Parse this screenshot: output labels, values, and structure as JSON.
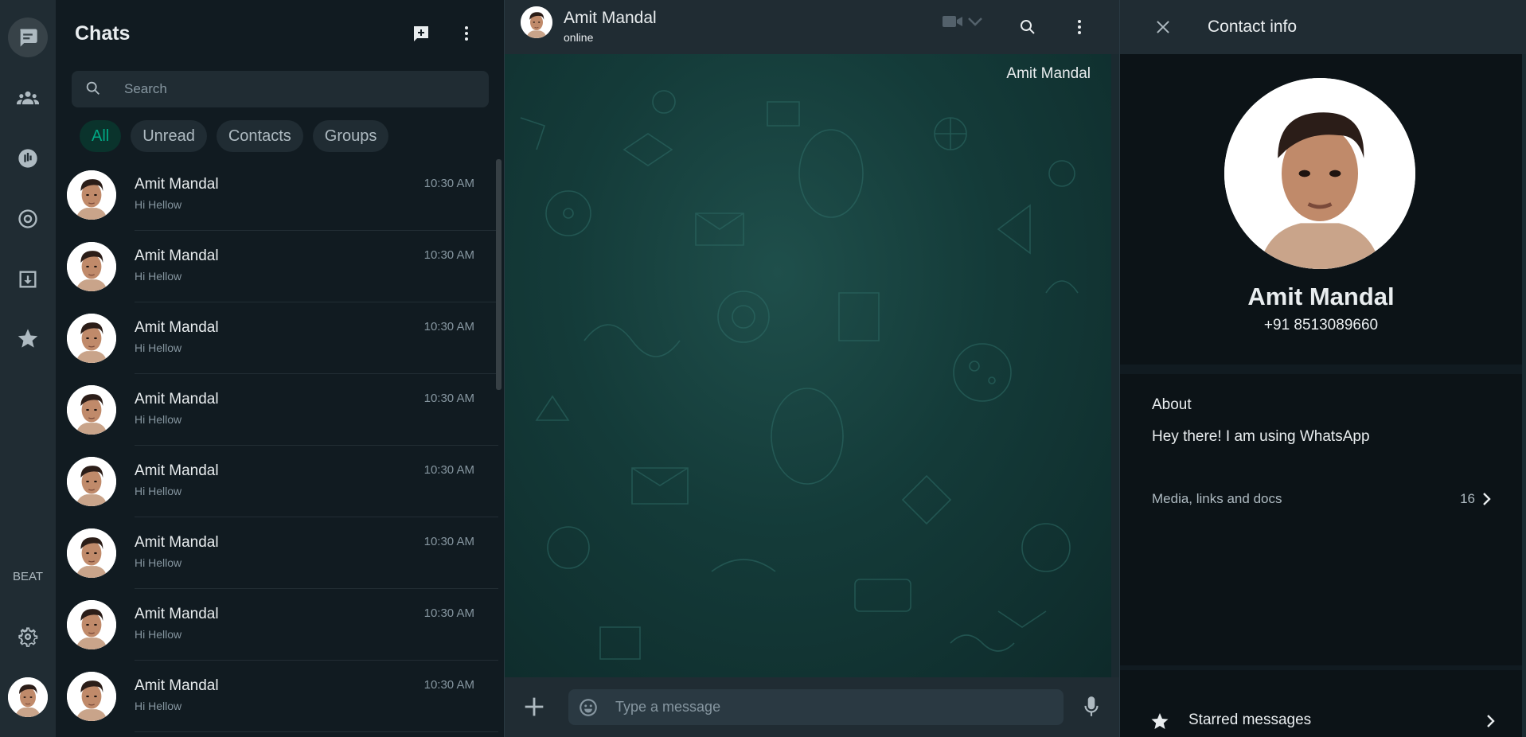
{
  "rail": {
    "items": [
      {
        "icon": "chats-icon",
        "active": true
      },
      {
        "icon": "communities-icon"
      },
      {
        "icon": "channels-icon"
      },
      {
        "icon": "status-icon"
      },
      {
        "icon": "archive-icon"
      },
      {
        "icon": "starred-icon"
      }
    ],
    "beta_label": "BEAT",
    "settings_icon": "gear-icon"
  },
  "chat_list": {
    "title": "Chats",
    "new_chat_icon": "new-chat-icon",
    "menu_icon": "more-vertical-icon",
    "search": {
      "placeholder": "Search"
    },
    "filters": [
      "All",
      "Unread",
      "Contacts",
      "Groups"
    ],
    "active_filter": "All",
    "rows": [
      {
        "name": "Amit Mandal",
        "message": "Hi Hellow",
        "time": "10:30 AM"
      },
      {
        "name": "Amit Mandal",
        "message": "Hi Hellow",
        "time": "10:30 AM"
      },
      {
        "name": "Amit Mandal",
        "message": "Hi Hellow",
        "time": "10:30 AM"
      },
      {
        "name": "Amit Mandal",
        "message": "Hi Hellow",
        "time": "10:30 AM"
      },
      {
        "name": "Amit Mandal",
        "message": "Hi Hellow",
        "time": "10:30 AM"
      },
      {
        "name": "Amit Mandal",
        "message": "Hi Hellow",
        "time": "10:30 AM"
      },
      {
        "name": "Amit Mandal",
        "message": "Hi Hellow",
        "time": "10:30 AM"
      },
      {
        "name": "Amit Mandal",
        "message": "Hi Hellow",
        "time": "10:30 AM"
      }
    ]
  },
  "conversation": {
    "name": "Amit Mandal",
    "status": "online",
    "top_label": "Amit Mandal",
    "composer": {
      "placeholder": "Type a message"
    }
  },
  "contact_info": {
    "title": "Contact info",
    "name": "Amit Mandal",
    "phone": "+91 8513089660",
    "about_label": "About",
    "about_text": "Hey there! I am using WhatsApp",
    "media_label": "Media, links and docs",
    "media_count": "16",
    "starred_label": "Starred messages"
  },
  "colors": {
    "accent": "#00a884",
    "panel": "#202c33",
    "background": "#111b21"
  }
}
